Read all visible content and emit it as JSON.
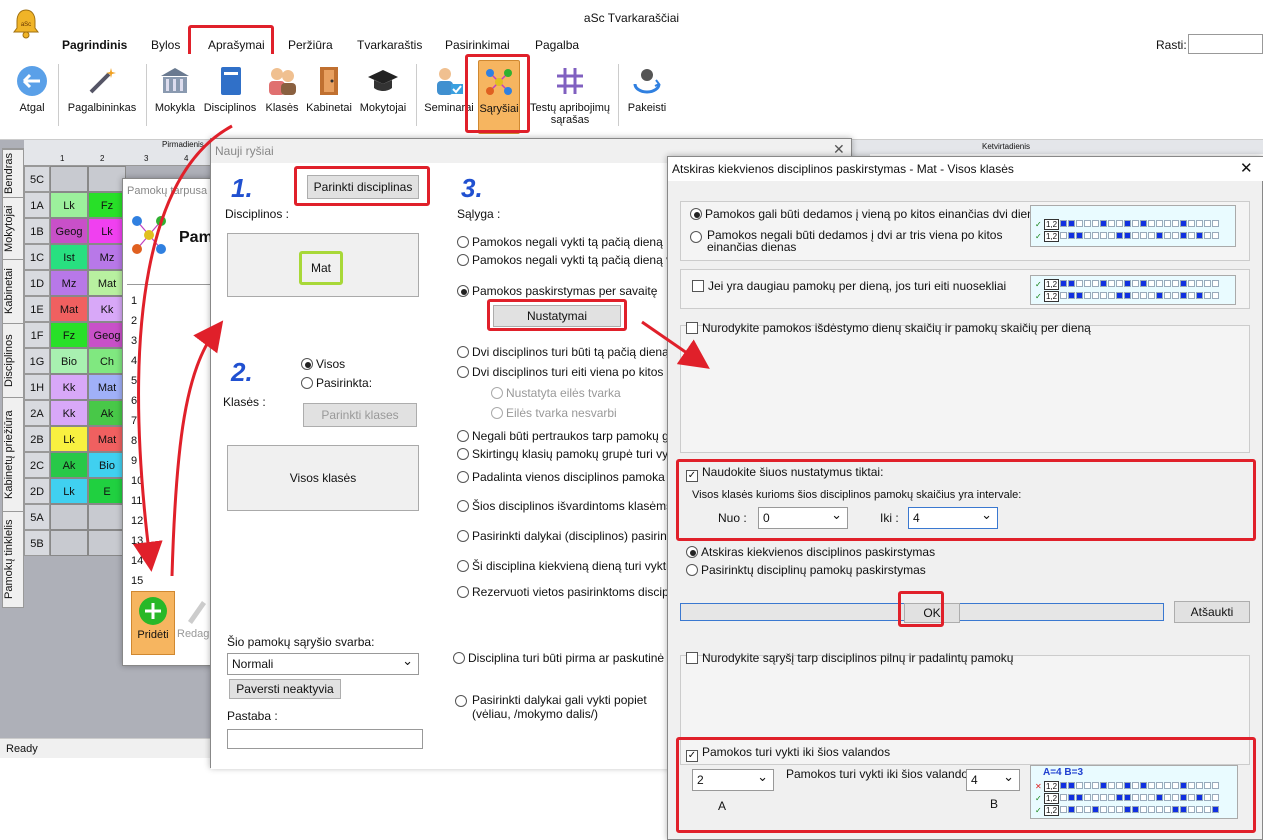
{
  "app": {
    "title": "aSc Tvarkaraščiai",
    "status": "Ready"
  },
  "menu": [
    "Pagrindinis",
    "Bylos",
    "Aprašymai",
    "Peržiūra",
    "Tvarkaraštis",
    "Pasirinkimai",
    "Pagalba"
  ],
  "find_label": "Rasti:",
  "ribbon": [
    {
      "label": "Atgal",
      "icon": "back-arrow-icon"
    },
    {
      "label": "Pagalbininkas",
      "icon": "magic-wand-icon"
    },
    {
      "label": "Mokykla",
      "icon": "school-building-icon"
    },
    {
      "label": "Disciplinos",
      "icon": "book-icon"
    },
    {
      "label": "Klasės",
      "icon": "students-icon"
    },
    {
      "label": "Kabinetai",
      "icon": "door-icon"
    },
    {
      "label": "Mokytojai",
      "icon": "graduation-cap-icon"
    },
    {
      "label": "Seminarai",
      "icon": "seminar-icon"
    },
    {
      "label": "Sąryšiai",
      "icon": "relations-network-icon"
    },
    {
      "label": "Testų apribojimų sąrašas",
      "icon": "hash-grid-icon"
    },
    {
      "label": "Pakeisti",
      "icon": "swap-person-icon"
    }
  ],
  "side_tabs": [
    "Bendras",
    "Mokytojai",
    "Kabinetai",
    "Disciplinos",
    "Kabinetų priežiūra",
    "Pamokų tinklelis"
  ],
  "grid": {
    "day_header": "Pirmadienis",
    "day_header_right": "Ketvirtadienis",
    "period_numbers": [
      "1",
      "2",
      "3",
      "4"
    ],
    "rows": [
      {
        "cls": "5C",
        "cells": [
          {
            "t": "",
            "c": ""
          },
          {
            "t": "",
            "c": ""
          }
        ]
      },
      {
        "cls": "1A",
        "cells": [
          {
            "t": "Lk",
            "c": "#9cf09c"
          },
          {
            "t": "Fz",
            "c": "#28e028"
          }
        ]
      },
      {
        "cls": "1B",
        "cells": [
          {
            "t": "Geog",
            "c": "#c850c8"
          },
          {
            "t": "Lk",
            "c": "#f040f0"
          }
        ]
      },
      {
        "cls": "1C",
        "cells": [
          {
            "t": "Ist",
            "c": "#28e080"
          },
          {
            "t": "Mz",
            "c": "#b878e8"
          }
        ]
      },
      {
        "cls": "1D",
        "cells": [
          {
            "t": "Mz",
            "c": "#b878e8"
          },
          {
            "t": "Mat",
            "c": "#b8f0a0"
          }
        ]
      },
      {
        "cls": "1E",
        "cells": [
          {
            "t": "Mat",
            "c": "#f06060"
          },
          {
            "t": "Kk",
            "c": "#d8a8f8"
          }
        ]
      },
      {
        "cls": "1F",
        "cells": [
          {
            "t": "Fz",
            "c": "#28e028"
          },
          {
            "t": "Geog",
            "c": "#c850c8"
          }
        ]
      },
      {
        "cls": "1G",
        "cells": [
          {
            "t": "Bio",
            "c": "#a8f0b0"
          },
          {
            "t": "Ch",
            "c": "#80e880"
          }
        ]
      },
      {
        "cls": "1H",
        "cells": [
          {
            "t": "Kk",
            "c": "#d8a8f8"
          },
          {
            "t": "Mat",
            "c": "#a0b0f8"
          }
        ]
      },
      {
        "cls": "2A",
        "cells": [
          {
            "t": "Kk",
            "c": "#d8a8f8"
          },
          {
            "t": "Ak",
            "c": "#48c848"
          }
        ]
      },
      {
        "cls": "2B",
        "cells": [
          {
            "t": "Lk",
            "c": "#f8f040"
          },
          {
            "t": "Mat",
            "c": "#f06060"
          }
        ]
      },
      {
        "cls": "2C",
        "cells": [
          {
            "t": "Ak",
            "c": "#28c848"
          },
          {
            "t": "Bio",
            "c": "#40d0f0"
          }
        ]
      },
      {
        "cls": "2D",
        "cells": [
          {
            "t": "Lk",
            "c": "#40d0f0"
          },
          {
            "t": "E",
            "c": "#20d040"
          }
        ]
      },
      {
        "cls": "5A",
        "cells": [
          {
            "t": "",
            "c": ""
          },
          {
            "t": "",
            "c": ""
          }
        ]
      },
      {
        "cls": "5B",
        "cells": [
          {
            "t": "",
            "c": ""
          },
          {
            "t": "",
            "c": ""
          }
        ]
      }
    ]
  },
  "small_dialog": {
    "title": "Pamokų tarpusa",
    "heading": "Pam",
    "rows": [
      "1",
      "2",
      "3",
      "4",
      "5",
      "6",
      "7",
      "8",
      "9",
      "10",
      "11",
      "12",
      "13",
      "14",
      "15"
    ],
    "add_label": "Pridėti",
    "edit_label": "Redagu"
  },
  "nauji": {
    "title": "Nauji ryšiai",
    "step1": "1.",
    "step2": "2.",
    "step3": "3.",
    "choose_subjects": "Parinkti disciplinas",
    "subjects_label": "Disciplinos :",
    "subject_value": "Mat",
    "classes_label": "Klasės :",
    "all_label": "Visos",
    "selected_label": "Pasirinkta:",
    "choose_classes": "Parinkti klases",
    "all_classes": "Visos klasės",
    "importance_label": "Šio pamokų sąryšio svarba:",
    "importance_value": "Normali",
    "make_inactive": "Paversti neaktyvia",
    "note_label": "Pastaba :",
    "condition_label": "Sąlyga :",
    "settings_button": "Nustatymai",
    "conditions": [
      "Pamokos negali vykti tą pačią dieną",
      "Pamokos negali vykti tą pačią dieną viena",
      "Pamokos paskirstymas per savaitę",
      "Dvi disciplinos turi būti tą pačią dieną",
      "Dvi disciplinos turi eiti viena po kitos",
      "Nustatyta eilės tvarka",
      "Eilės tvarka nesvarbi",
      "Negali būti pertraukos tarp pamokų grupė",
      "Skirtingų klasių pamokų grupė turi vykti ta",
      "Padalinta vienos disciplinos pamoka turi v",
      "Šios disciplinos išvardintoms klasėms turi",
      "Pasirinkti dalykai (disciplinos) pasirinktose",
      "Ši disciplina kiekvieną dieną turi vykti tuo",
      "Rezervuoti vietos pasirinktoms disciplinor",
      "Disciplina turi būti pirma ar paskutinė",
      "Pasirinkti dalykai gali vykti popiet (vėliau, /mokymo dalis/)"
    ]
  },
  "settings": {
    "title": "Atskiras kiekvienos disciplinos paskirstymas - Mat - Visos klasės",
    "opt1": "Pamokos gali būti dedamos į vieną po kitos einančias dvi dienas",
    "opt2": "Pamokos negali būti dedamos į dvi ar tris viena po kitos einančias dienas",
    "consecutive": "Jei yra daugiau pamokų per dieną, jos turi eiti nuosekliai",
    "spread_days": "Nurodykite pamokos išdėstymo dienų skaičių ir pamokų skaičių per dieną",
    "use_only": "Naudokite šiuos nustatymus tiktai:",
    "range_text": "Visos klasės kurioms šios disciplinos pamokų skaičius yra intervale:",
    "from_label": "Nuo :",
    "from_value": "0",
    "to_label": "Iki :",
    "to_value": "4",
    "sep_distribution": "Atskiras kiekvienos disciplinos paskirstymas",
    "sel_distribution": "Pasirinktų disciplinų pamokų paskirstymas",
    "ok": "OK",
    "cancel": "Atšaukti",
    "full_split": "Nurodykite sąryšį tarp disciplinos pilnų ir padalintų pamokų",
    "until_hour": "Pamokos turi vykti iki šios valandos",
    "until_hour2": "Pamokos turi vykti iki šios valandos",
    "a_value": "2",
    "a_label": "A",
    "b_value": "4",
    "b_label": "B",
    "mini_legend": "A=4 B=3",
    "mini_tag": "1,2"
  }
}
